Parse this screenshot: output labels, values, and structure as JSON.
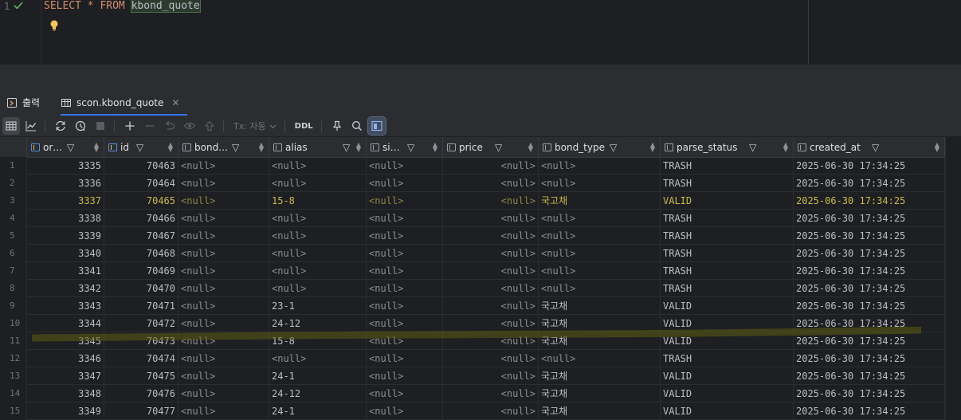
{
  "editor": {
    "line_number": "1",
    "sql_keyword_select": "SELECT",
    "sql_star": "*",
    "sql_keyword_from": "FROM",
    "sql_table": "kbond_quote"
  },
  "tabs": [
    {
      "label": "출력",
      "icon": "output-icon"
    },
    {
      "label": "scon.kbond_quote",
      "icon": "table-icon"
    }
  ],
  "toolbar": {
    "tx_mode": "Tx: 자동",
    "ddl_label": "DDL"
  },
  "columns": [
    {
      "label": "or…",
      "icon": "key-column-icon"
    },
    {
      "label": "id",
      "icon": "key-column-icon"
    },
    {
      "label": "bond…",
      "icon": "column-icon"
    },
    {
      "label": "alias",
      "icon": "column-icon"
    },
    {
      "label": "si…",
      "icon": "column-icon"
    },
    {
      "label": "price",
      "icon": "column-icon"
    },
    {
      "label": "bond_type",
      "icon": "column-icon"
    },
    {
      "label": "parse_status",
      "icon": "column-icon"
    },
    {
      "label": "created_at",
      "icon": "column-icon"
    }
  ],
  "rows": [
    {
      "n": "1",
      "or": "3335",
      "id": "70463",
      "bond": "<null>",
      "alias": "<null>",
      "si": "<null>",
      "price": "<null>",
      "bond_type": "<null>",
      "parse_status": "TRASH",
      "created_at": "2025-06-30 17:34:25"
    },
    {
      "n": "2",
      "or": "3336",
      "id": "70464",
      "bond": "<null>",
      "alias": "<null>",
      "si": "<null>",
      "price": "<null>",
      "bond_type": "<null>",
      "parse_status": "TRASH",
      "created_at": "2025-06-30 17:34:25"
    },
    {
      "n": "3",
      "or": "3337",
      "id": "70465",
      "bond": "<null>",
      "alias": "15-8",
      "si": "<null>",
      "price": "<null>",
      "bond_type": "국고채",
      "parse_status": "VALID",
      "created_at": "2025-06-30 17:34:25"
    },
    {
      "n": "4",
      "or": "3338",
      "id": "70466",
      "bond": "<null>",
      "alias": "<null>",
      "si": "<null>",
      "price": "<null>",
      "bond_type": "<null>",
      "parse_status": "TRASH",
      "created_at": "2025-06-30 17:34:25"
    },
    {
      "n": "5",
      "or": "3339",
      "id": "70467",
      "bond": "<null>",
      "alias": "<null>",
      "si": "<null>",
      "price": "<null>",
      "bond_type": "<null>",
      "parse_status": "TRASH",
      "created_at": "2025-06-30 17:34:25"
    },
    {
      "n": "6",
      "or": "3340",
      "id": "70468",
      "bond": "<null>",
      "alias": "<null>",
      "si": "<null>",
      "price": "<null>",
      "bond_type": "<null>",
      "parse_status": "TRASH",
      "created_at": "2025-06-30 17:34:25"
    },
    {
      "n": "7",
      "or": "3341",
      "id": "70469",
      "bond": "<null>",
      "alias": "<null>",
      "si": "<null>",
      "price": "<null>",
      "bond_type": "<null>",
      "parse_status": "TRASH",
      "created_at": "2025-06-30 17:34:25"
    },
    {
      "n": "8",
      "or": "3342",
      "id": "70470",
      "bond": "<null>",
      "alias": "<null>",
      "si": "<null>",
      "price": "<null>",
      "bond_type": "<null>",
      "parse_status": "TRASH",
      "created_at": "2025-06-30 17:34:25"
    },
    {
      "n": "9",
      "or": "3343",
      "id": "70471",
      "bond": "<null>",
      "alias": "23-1",
      "si": "<null>",
      "price": "<null>",
      "bond_type": "국고채",
      "parse_status": "VALID",
      "created_at": "2025-06-30 17:34:25"
    },
    {
      "n": "10",
      "or": "3344",
      "id": "70472",
      "bond": "<null>",
      "alias": "24-12",
      "si": "<null>",
      "price": "<null>",
      "bond_type": "국고채",
      "parse_status": "VALID",
      "created_at": "2025-06-30 17:34:25"
    },
    {
      "n": "11",
      "or": "3345",
      "id": "70473",
      "bond": "<null>",
      "alias": "15-8",
      "si": "<null>",
      "price": "<null>",
      "bond_type": "국고채",
      "parse_status": "VALID",
      "created_at": "2025-06-30 17:34:25"
    },
    {
      "n": "12",
      "or": "3346",
      "id": "70474",
      "bond": "<null>",
      "alias": "<null>",
      "si": "<null>",
      "price": "<null>",
      "bond_type": "<null>",
      "parse_status": "TRASH",
      "created_at": "2025-06-30 17:34:25"
    },
    {
      "n": "13",
      "or": "3347",
      "id": "70475",
      "bond": "<null>",
      "alias": "24-1",
      "si": "<null>",
      "price": "<null>",
      "bond_type": "국고채",
      "parse_status": "VALID",
      "created_at": "2025-06-30 17:34:25"
    },
    {
      "n": "14",
      "or": "3348",
      "id": "70476",
      "bond": "<null>",
      "alias": "24-12",
      "si": "<null>",
      "price": "<null>",
      "bond_type": "국고채",
      "parse_status": "VALID",
      "created_at": "2025-06-30 17:34:25"
    },
    {
      "n": "15",
      "or": "3349",
      "id": "70477",
      "bond": "<null>",
      "alias": "24-1",
      "si": "<null>",
      "price": "<null>",
      "bond_type": "국고채",
      "parse_status": "VALID",
      "created_at": "2025-06-30 17:34:25"
    }
  ]
}
